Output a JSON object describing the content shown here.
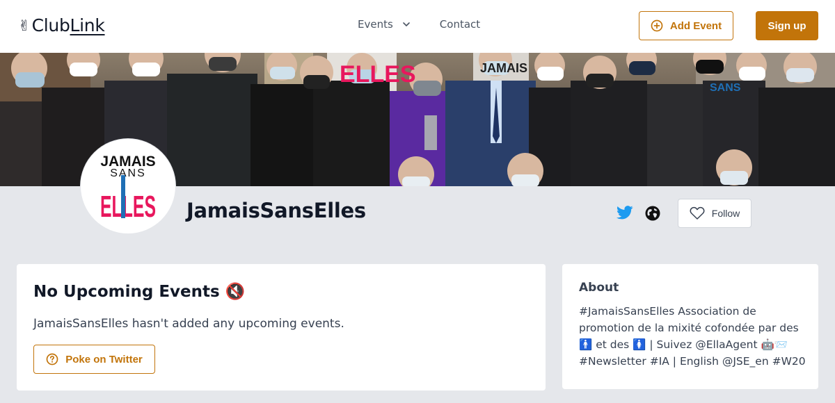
{
  "header": {
    "logo_hand": "✌",
    "logo_club": "Club",
    "logo_link": "Link",
    "nav": {
      "events_label": "Events",
      "contact_label": "Contact"
    },
    "add_event_label": "Add Event",
    "signup_label": "Sign up"
  },
  "banner": {
    "logo_jamais": "JAMAIS",
    "logo_sans": "SANS",
    "logo_elles": "ELLES"
  },
  "profile": {
    "avatar": {
      "jamais": "JAMAIS",
      "sans": "SANS",
      "elles": "ELLES"
    },
    "name": "JamaisSansElles",
    "follow_label": "Follow",
    "icons": [
      "twitter-icon",
      "globe-icon",
      "heart-icon"
    ]
  },
  "events_card": {
    "title": "No Upcoming Events",
    "title_emoji": "🔇",
    "message": "JamaisSansElles hasn't added any upcoming events.",
    "poke_label": "Poke on Twitter"
  },
  "about_card": {
    "title": "About",
    "text": "#JamaisSansElles Association de promotion de la mixité cofondée par des 🚹 et des 🚺 | Suivez @EllaAgent 🤖📨 #Newsletter #IA | English @JSE_en #W20"
  },
  "colors": {
    "accent": "#c2740a",
    "twitter": "#1d9bf0",
    "page_bg": "#e5e7eb",
    "brand_pink": "#e8175d",
    "brand_blue": "#1f6fb5"
  }
}
